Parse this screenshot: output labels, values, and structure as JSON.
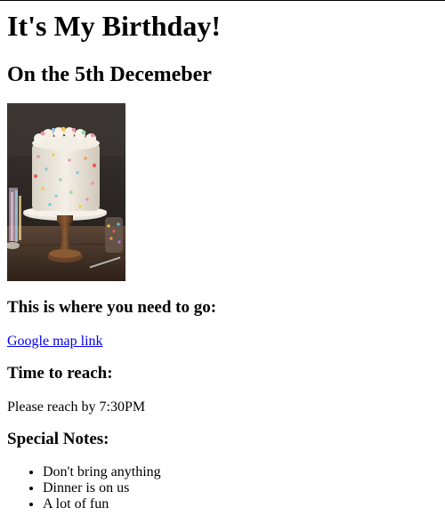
{
  "header": {
    "title": "It's My Birthday!",
    "subtitle": "On the 5th Decemeber"
  },
  "image": {
    "icon": "birthday-cake-image"
  },
  "location": {
    "heading": "This is where you need to go:",
    "link_text": "Google map link"
  },
  "time": {
    "heading": "Time to reach:",
    "text": "Please reach by 7:30PM"
  },
  "notes": {
    "heading": "Special Notes:",
    "items": [
      "Don't bring anything",
      "Dinner is on us",
      "A lot of fun"
    ]
  }
}
